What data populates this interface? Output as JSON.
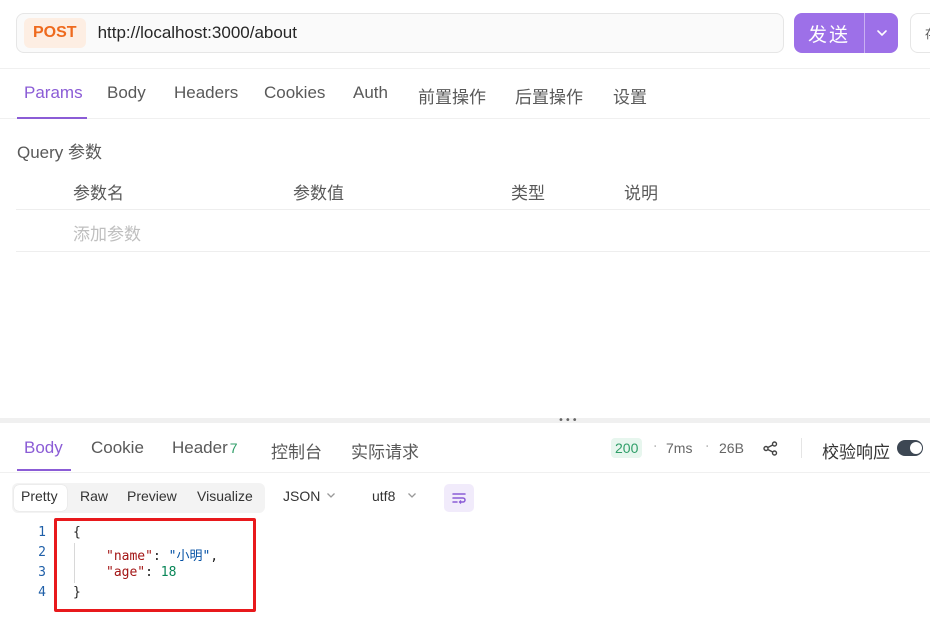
{
  "request": {
    "method": "POST",
    "url": "http://localhost:3000/about",
    "send_label": "发送",
    "extra_label": "存"
  },
  "request_tabs": [
    "Params",
    "Body",
    "Headers",
    "Cookies",
    "Auth",
    "前置操作",
    "后置操作",
    "设置"
  ],
  "query": {
    "title": "Query 参数",
    "headers": [
      "参数名",
      "参数值",
      "类型",
      "说明"
    ],
    "add_placeholder": "添加参数"
  },
  "response_tabs": {
    "body": "Body",
    "cookie": "Cookie",
    "header": "Header",
    "header_count": "7",
    "console": "控制台",
    "actual_request": "实际请求"
  },
  "response_meta": {
    "status": "200",
    "time": "7ms",
    "size": "26B",
    "validate_label": "校验响应"
  },
  "view_modes": [
    "Pretty",
    "Raw",
    "Preview",
    "Visualize"
  ],
  "format_select": "JSON",
  "encoding_select": "utf8",
  "code": {
    "line_numbers": [
      "1",
      "2",
      "3",
      "4"
    ],
    "open_brace": "{",
    "name_key": "\"name\"",
    "name_value": "\"小明\"",
    "age_key": "\"age\"",
    "age_value": "18",
    "close_brace": "}"
  },
  "colors": {
    "accent": "#8b5cd6",
    "send_button": "#9d70e8",
    "method": "#ee6a1e",
    "status_ok": "#2f9e68",
    "highlight": "#e8191c"
  }
}
